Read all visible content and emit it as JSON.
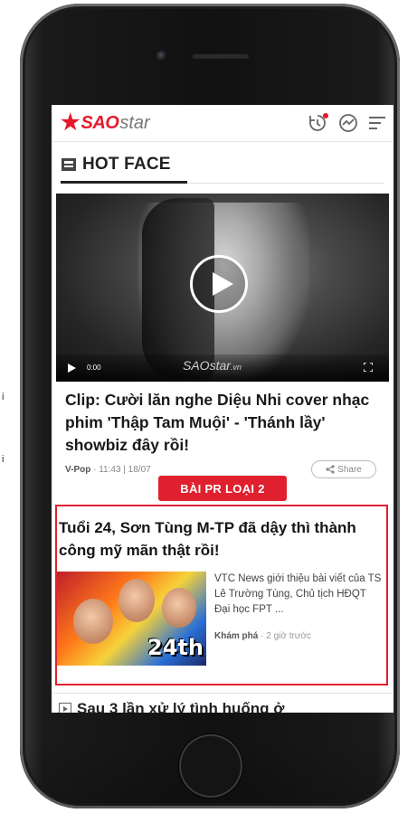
{
  "side_fragments": [
    "i",
    "",
    "i"
  ],
  "header": {
    "logo_sao": "SAO",
    "logo_star": "star",
    "icons": [
      "history-icon",
      "trending-icon",
      "menu-icon"
    ]
  },
  "section": {
    "title": "HOT FACE"
  },
  "video": {
    "time": "0:00",
    "watermark_main": "SAOstar",
    "watermark_suffix": ".vn"
  },
  "article": {
    "title": "Clip: Cười lăn nghe Diệu Nhi cover nhạc phim 'Thập Tam Muội' - 'Thánh lầy' showbiz đây rồi!",
    "category": "V-Pop",
    "meta": "· 11:43 | 18/07",
    "share_label": "Share"
  },
  "pr": {
    "label": "BÀI PR LOẠI 2",
    "title": "Tuổi 24, Sơn Tùng M-TP đã dậy thì thành công mỹ mãn thật rồi!",
    "thumb_text": "24th",
    "description": "VTC News giới thiệu bài viết của TS Lê Trường Tùng, Chủ tịch HĐQT Đại học FPT ...",
    "category": "Khám phá",
    "time": "· 2 giờ trước"
  },
  "next": {
    "title": "Sau 3 lần xử lý tình huống ở"
  },
  "colors": {
    "brand_red": "#e8192c",
    "pr_red": "#e0202e"
  }
}
